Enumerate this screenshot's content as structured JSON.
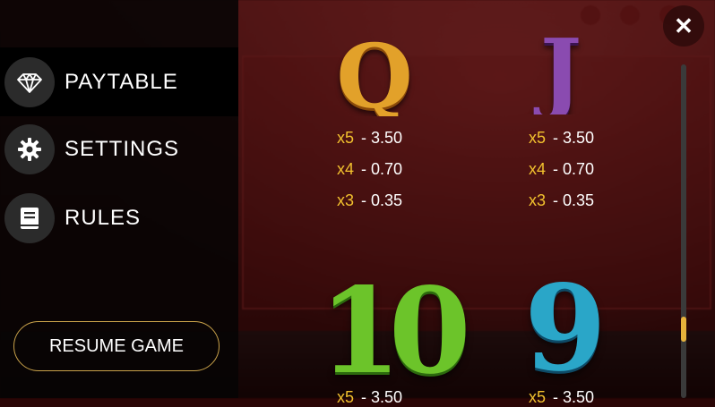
{
  "menu": {
    "items": [
      {
        "label": "PAYTABLE",
        "icon": "diamond-icon",
        "active": true
      },
      {
        "label": "SETTINGS",
        "icon": "gear-icon",
        "active": false
      },
      {
        "label": "RULES",
        "icon": "book-icon",
        "active": false
      }
    ],
    "resume_label": "RESUME GAME"
  },
  "paytable": {
    "symbols": [
      {
        "glyph": "Q",
        "color": "#e2a12a",
        "payouts": [
          {
            "mult": "x5",
            "value": "- 3.50"
          },
          {
            "mult": "x4",
            "value": "- 0.70"
          },
          {
            "mult": "x3",
            "value": "- 0.35"
          }
        ]
      },
      {
        "glyph": "J",
        "color": "#8a4bb0",
        "payouts": [
          {
            "mult": "x5",
            "value": "- 3.50"
          },
          {
            "mult": "x4",
            "value": "- 0.70"
          },
          {
            "mult": "x3",
            "value": "- 0.35"
          }
        ]
      },
      {
        "glyph": "10",
        "color": "#6cc42a",
        "payouts": [
          {
            "mult": "x5",
            "value": "- 3.50"
          }
        ]
      },
      {
        "glyph": "9",
        "color": "#2aa6c8",
        "payouts": [
          {
            "mult": "x5",
            "value": "- 3.50"
          }
        ]
      }
    ]
  },
  "close_label": "✕",
  "colors": {
    "accent": "#e7b23b",
    "multiplier": "#f2c12e"
  }
}
